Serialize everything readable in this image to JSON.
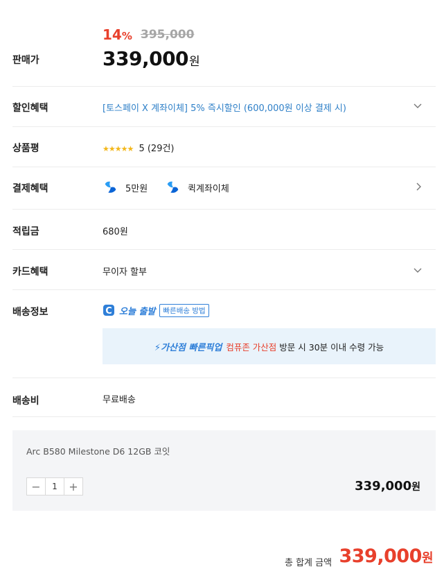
{
  "price": {
    "label": "판매가",
    "discount_percent": "14",
    "discount_symbol": "%",
    "original": "395,000",
    "sale": "339,000",
    "unit": "원"
  },
  "discount_benefit": {
    "label": "할인혜택",
    "text": "[토스페이 X 계좌이체] 5% 즉시할인 (600,000원 이상 결제 시)"
  },
  "review": {
    "label": "상품평",
    "stars": "★★★★★",
    "score": "5 (29건)"
  },
  "payment_benefit": {
    "label": "결제혜택",
    "items": [
      "5만원",
      "퀵계좌이체"
    ]
  },
  "points": {
    "label": "적립금",
    "value": "680원"
  },
  "card_benefit": {
    "label": "카드혜택",
    "value": "무이자 할부"
  },
  "shipping_info": {
    "label": "배송정보",
    "today_text": "오늘 출발",
    "method_link": "빠른배송 방법",
    "pickup_title": "가산점 빠른픽업",
    "pickup_store": "컴퓨존 가산점",
    "pickup_desc": "방문 시 30분 이내 수령 가능"
  },
  "shipping_fee": {
    "label": "배송비",
    "value": "무료배송"
  },
  "option": {
    "name": "Arc B580 Milestone D6 12GB 코잇",
    "quantity": "1",
    "minus": "−",
    "plus": "+",
    "price": "339,000",
    "unit": "원"
  },
  "total": {
    "label": "총 합계 금액",
    "price": "339,000",
    "unit": "원"
  },
  "colors": {
    "accent_red": "#e8402c",
    "accent_blue": "#2f80c8",
    "star": "#f3b71b"
  }
}
